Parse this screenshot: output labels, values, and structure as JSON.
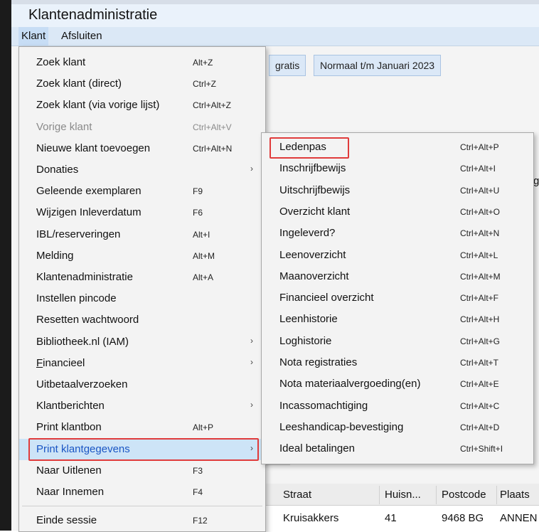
{
  "window": {
    "title": "Klantenadministratie"
  },
  "menubar": {
    "items": [
      "Klant",
      "Afsluiten"
    ]
  },
  "background": {
    "chips": [
      "gratis",
      "Normaal t/m Januari 2023"
    ],
    "edge_char": "g",
    "grid": {
      "headers": [
        "Straat",
        "Huisn...",
        "Postcode",
        "Plaats"
      ],
      "row": [
        "Kruisakkers",
        "41",
        "9468 BG",
        "ANNEN"
      ]
    }
  },
  "klant_menu": {
    "items": [
      {
        "label": "Zoek klant",
        "shortcut": "Alt+Z"
      },
      {
        "label": "Zoek klant (direct)",
        "shortcut": "Ctrl+Z"
      },
      {
        "label": "Zoek klant (via vorige lijst)",
        "shortcut": "Ctrl+Alt+Z"
      },
      {
        "label": "Vorige klant",
        "shortcut": "Ctrl+Alt+V",
        "disabled": true
      },
      {
        "label": "Nieuwe klant toevoegen",
        "shortcut": "Ctrl+Alt+N"
      },
      {
        "label": "Donaties",
        "shortcut": "",
        "submenu": true
      },
      {
        "label": "Geleende exemplaren",
        "shortcut": "F9"
      },
      {
        "label": "Wijzigen Inleverdatum",
        "shortcut": "F6"
      },
      {
        "label": "IBL/reserveringen",
        "shortcut": "Alt+I"
      },
      {
        "label": "Melding",
        "shortcut": "Alt+M"
      },
      {
        "label": "Klantenadministratie",
        "shortcut": "Alt+A"
      },
      {
        "label": "Instellen pincode",
        "shortcut": ""
      },
      {
        "label": "Resetten wachtwoord",
        "shortcut": ""
      },
      {
        "label": "Bibliotheek.nl (IAM)",
        "shortcut": "",
        "submenu": true
      },
      {
        "label": "Financieel",
        "shortcut": "",
        "submenu": true,
        "mnemonic": true
      },
      {
        "label": "Uitbetaalverzoeken",
        "shortcut": ""
      },
      {
        "label": "Klantberichten",
        "shortcut": "",
        "submenu": true
      },
      {
        "label": "Print klantbon",
        "shortcut": "Alt+P"
      },
      {
        "label": "Print klantgegevens",
        "shortcut": "",
        "submenu": true,
        "highlighted": true
      },
      {
        "label": "Naar Uitlenen",
        "shortcut": "F3"
      },
      {
        "label": "Naar Innemen",
        "shortcut": "F4"
      },
      {
        "label": "Einde sessie",
        "shortcut": "F12",
        "separator_before": true
      }
    ]
  },
  "print_submenu": {
    "items": [
      {
        "label": "Ledenpas",
        "shortcut": "Ctrl+Alt+P",
        "boxed": true
      },
      {
        "label": "Inschrijfbewijs",
        "shortcut": "Ctrl+Alt+I"
      },
      {
        "label": "Uitschrijfbewijs",
        "shortcut": "Ctrl+Alt+U"
      },
      {
        "label": "Overzicht klant",
        "shortcut": "Ctrl+Alt+O"
      },
      {
        "label": "Ingeleverd?",
        "shortcut": "Ctrl+Alt+N"
      },
      {
        "label": "Leenoverzicht",
        "shortcut": "Ctrl+Alt+L"
      },
      {
        "label": "Maanoverzicht",
        "shortcut": "Ctrl+Alt+M"
      },
      {
        "label": "Financieel overzicht",
        "shortcut": "Ctrl+Alt+F"
      },
      {
        "label": "Leenhistorie",
        "shortcut": "Ctrl+Alt+H"
      },
      {
        "label": "Loghistorie",
        "shortcut": "Ctrl+Alt+G"
      },
      {
        "label": "Nota registraties",
        "shortcut": "Ctrl+Alt+T"
      },
      {
        "label": "Nota materiaalvergoeding(en)",
        "shortcut": "Ctrl+Alt+E"
      },
      {
        "label": "Incassomachtiging",
        "shortcut": "Ctrl+Alt+C"
      },
      {
        "label": "Leeshandicap-bevestiging",
        "shortcut": "Ctrl+Alt+D"
      },
      {
        "label": "Ideal betalingen",
        "shortcut": "Ctrl+Shift+I"
      }
    ]
  },
  "colors": {
    "highlight": "#cde4f7",
    "highlight_text": "#1a56c4",
    "callout": "#e03b3b"
  }
}
